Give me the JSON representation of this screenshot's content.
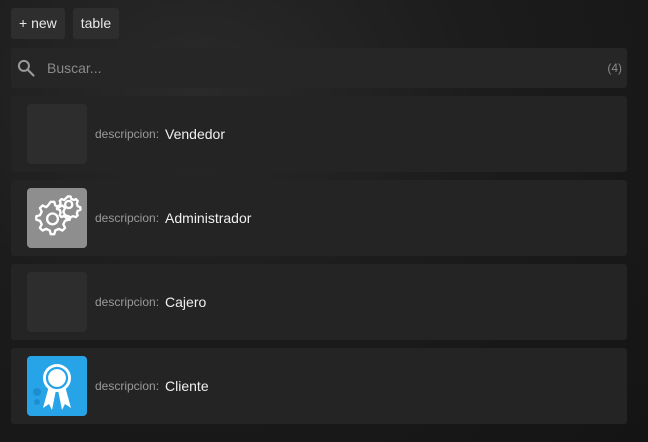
{
  "toolbar": {
    "new_label": "+ new",
    "table_label": "table"
  },
  "search": {
    "placeholder": "Buscar...",
    "count": "(4)"
  },
  "list": {
    "field_label": "descripcion:",
    "items": [
      {
        "descripcion": "Vendedor",
        "icon": "blank-thumbnail"
      },
      {
        "descripcion": "Administrador",
        "icon": "gear-icon"
      },
      {
        "descripcion": "Cajero",
        "icon": "blank-thumbnail"
      },
      {
        "descripcion": "Cliente",
        "icon": "award-ribbon-icon"
      }
    ]
  },
  "colors": {
    "row_background": "#242424",
    "gear_thumb": "#8e8e8e",
    "award_thumb": "#27a3e8"
  }
}
